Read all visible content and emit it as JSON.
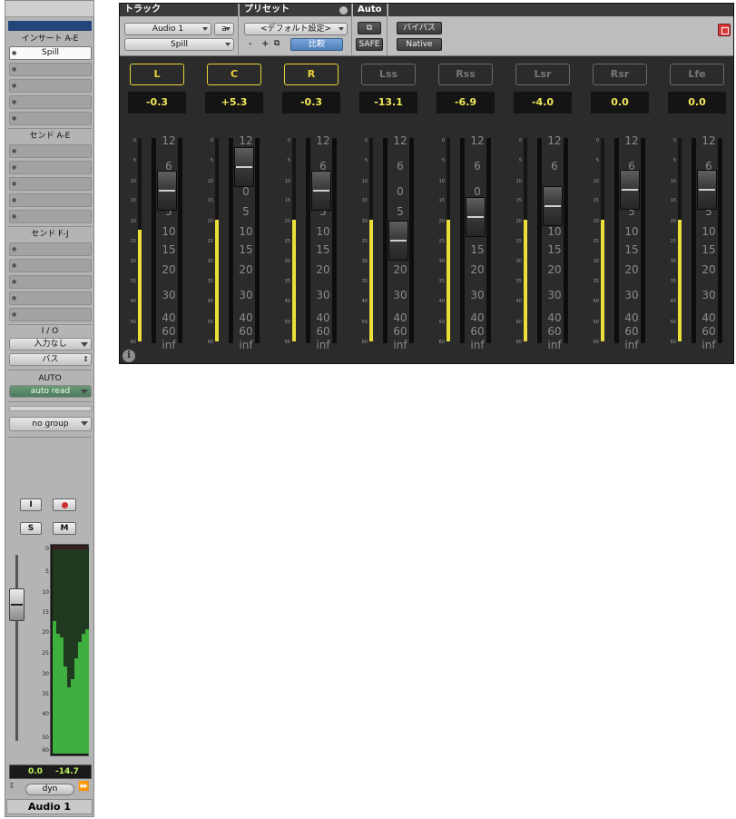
{
  "strip": {
    "inserts_header": "インサート A-E",
    "inserts": [
      "Spill",
      "",
      "",
      "",
      ""
    ],
    "sends_ae_header": "センド A-E",
    "sends_fj_header": "センド F-J",
    "io_header": "I / O",
    "input": "入力なし",
    "output": "バス",
    "auto_header": "AUTO",
    "auto_mode": "auto read",
    "group": "no group",
    "input_btn": "I",
    "solo_btn": "S",
    "mute_btn": "M",
    "meter_scale": [
      "0",
      "5",
      "10",
      "15",
      "20",
      "25",
      "30",
      "35",
      "40",
      "50",
      "60"
    ],
    "meter_levels": [
      0.64,
      0.58,
      0.56,
      0.42,
      0.32,
      0.36,
      0.46,
      0.54,
      0.58,
      0.6
    ],
    "fader_value": "0.0",
    "peak_value": "-14.7",
    "dyn_label": "dyn",
    "track_name": "Audio 1"
  },
  "plugin": {
    "track_header": "トラック",
    "track_name": "Audio 1",
    "track_suffix": "a",
    "plugin_name": "Spill",
    "preset_header": "プリセット",
    "preset_name": "<デフォルト設定>",
    "minus_label": "-",
    "plus_label": "+",
    "compare_label": "比較",
    "auto_header": "Auto",
    "safe_label": "SAFE",
    "bypass_label": "バイパス",
    "native_label": "Native",
    "fader_scale": [
      "12",
      "6",
      "0",
      "5",
      "10",
      "15",
      "20",
      "30",
      "40",
      "60",
      "inf"
    ],
    "meter_scale": [
      "0",
      "5",
      "10",
      "15",
      "20",
      "25",
      "30",
      "35",
      "40",
      "50",
      "60"
    ],
    "info_icon": "i",
    "channels": [
      {
        "name": "L",
        "value": "-0.3",
        "active": true,
        "meter": 0.55,
        "fader_db": -0.3
      },
      {
        "name": "C",
        "value": "+5.3",
        "active": true,
        "meter": 0.6,
        "fader_db": 5.3
      },
      {
        "name": "R",
        "value": "-0.3",
        "active": true,
        "meter": 0.6,
        "fader_db": -0.3
      },
      {
        "name": "Lss",
        "value": "-13.1",
        "active": false,
        "meter": 0.6,
        "fader_db": -13.1
      },
      {
        "name": "Rss",
        "value": "-6.9",
        "active": false,
        "meter": 0.6,
        "fader_db": -6.9
      },
      {
        "name": "Lsr",
        "value": "-4.0",
        "active": false,
        "meter": 0.6,
        "fader_db": -4.0
      },
      {
        "name": "Rsr",
        "value": "0.0",
        "active": false,
        "meter": 0.6,
        "fader_db": 0.0
      },
      {
        "name": "Lfe",
        "value": "0.0",
        "active": false,
        "meter": 0.6,
        "fader_db": 0.0
      }
    ]
  },
  "colors": {
    "accent_yellow": "#e8d23a",
    "meter_green": "#3faf3f",
    "compare_blue": "#4d7fb9"
  }
}
